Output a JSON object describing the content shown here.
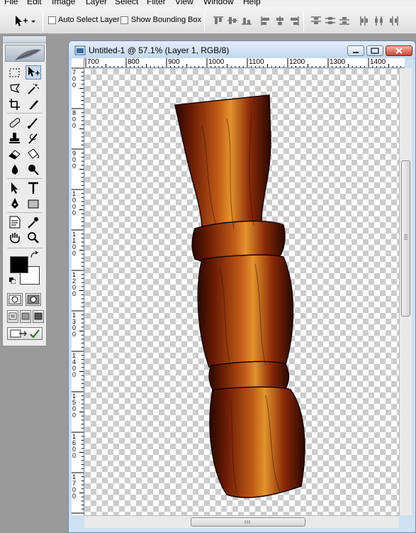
{
  "menu": [
    "File",
    "Edit",
    "Image",
    "Layer",
    "Select",
    "Filter",
    "View",
    "Window",
    "Help"
  ],
  "options_bar": {
    "auto_select_label": "Auto Select Layer",
    "show_bounding_label": "Show Bounding Box"
  },
  "document": {
    "title": "Untitled-1 @ 57.1% (Layer 1, RGB/8)",
    "zoom": "57.1%",
    "ruler_top": [
      "700",
      "800",
      "900",
      "1000",
      "1100",
      "1200",
      "1300",
      "1400"
    ],
    "ruler_left": [
      "700",
      "800",
      "900",
      "1000",
      "1100",
      "1200",
      "1300",
      "1400",
      "1500",
      "1600",
      "1700"
    ]
  },
  "colors": {
    "foreground": "#000000",
    "background": "#ffffff",
    "wood_dark": "#3a0e02",
    "wood_mid": "#8a2a08",
    "wood_light": "#e0902a"
  },
  "icons": [
    "move-tool-icon",
    "marquee-icon",
    "lasso-icon",
    "magic-wand-icon",
    "crop-icon",
    "slice-icon",
    "healing-icon",
    "brush-icon",
    "stamp-icon",
    "history-brush-icon",
    "eraser-icon",
    "bucket-icon",
    "blur-icon",
    "dodge-icon",
    "path-select-icon",
    "type-icon",
    "pen-icon",
    "shape-icon",
    "notes-icon",
    "eyedropper-icon",
    "hand-icon",
    "zoom-icon"
  ]
}
